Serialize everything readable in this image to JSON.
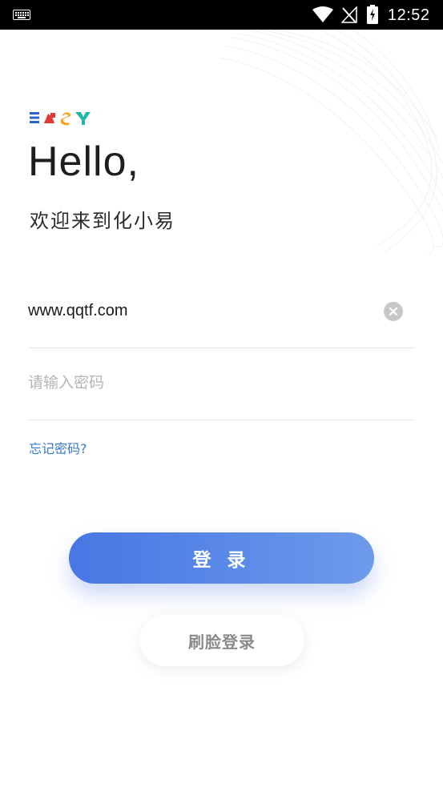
{
  "status_bar": {
    "time": "12:52",
    "icons": [
      "keyboard-icon",
      "wifi-icon",
      "no-signal-icon",
      "battery-charging-icon"
    ]
  },
  "brand": {
    "logo_text": "EASY",
    "logo_colors": [
      "#2a63d0",
      "#e53935",
      "#f5a623",
      "#20b7a6"
    ]
  },
  "header": {
    "greeting": "Hello,",
    "welcome": "欢迎来到化小易"
  },
  "form": {
    "username_value": "www.qqtf.com",
    "password_placeholder": "请输入密码",
    "clear_icon": "clear-icon",
    "forgot_password": "忘记密码?"
  },
  "actions": {
    "login_label": "登 录",
    "face_login_label": "刷脸登录"
  },
  "colors": {
    "accent": "#4777e3",
    "link": "#3a78d8",
    "status_bar_bg": "#000000"
  }
}
